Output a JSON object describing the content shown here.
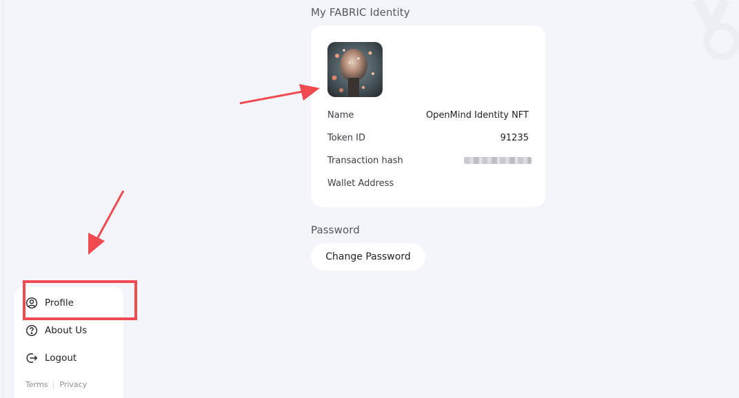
{
  "identity": {
    "section_title": "My FABRIC Identity",
    "image_icon": "nft-avatar-image",
    "rows": [
      {
        "label": "Name",
        "value": "OpenMind Identity NFT"
      },
      {
        "label": "Token ID",
        "value": "91235"
      },
      {
        "label": "Transaction hash",
        "value": ""
      },
      {
        "label": "Wallet Address",
        "value": ""
      }
    ]
  },
  "password": {
    "section_title": "Password",
    "change_label": "Change Password"
  },
  "menu": {
    "items": [
      {
        "label": "Profile",
        "icon": "user-circle-icon"
      },
      {
        "label": "About Us",
        "icon": "question-circle-icon"
      },
      {
        "label": "Logout",
        "icon": "logout-icon"
      }
    ],
    "footer": {
      "terms": "Terms",
      "privacy": "Privacy"
    }
  },
  "colors": {
    "background": "#f4f5fa",
    "card": "#ffffff",
    "annotation": "#ef4b50"
  }
}
